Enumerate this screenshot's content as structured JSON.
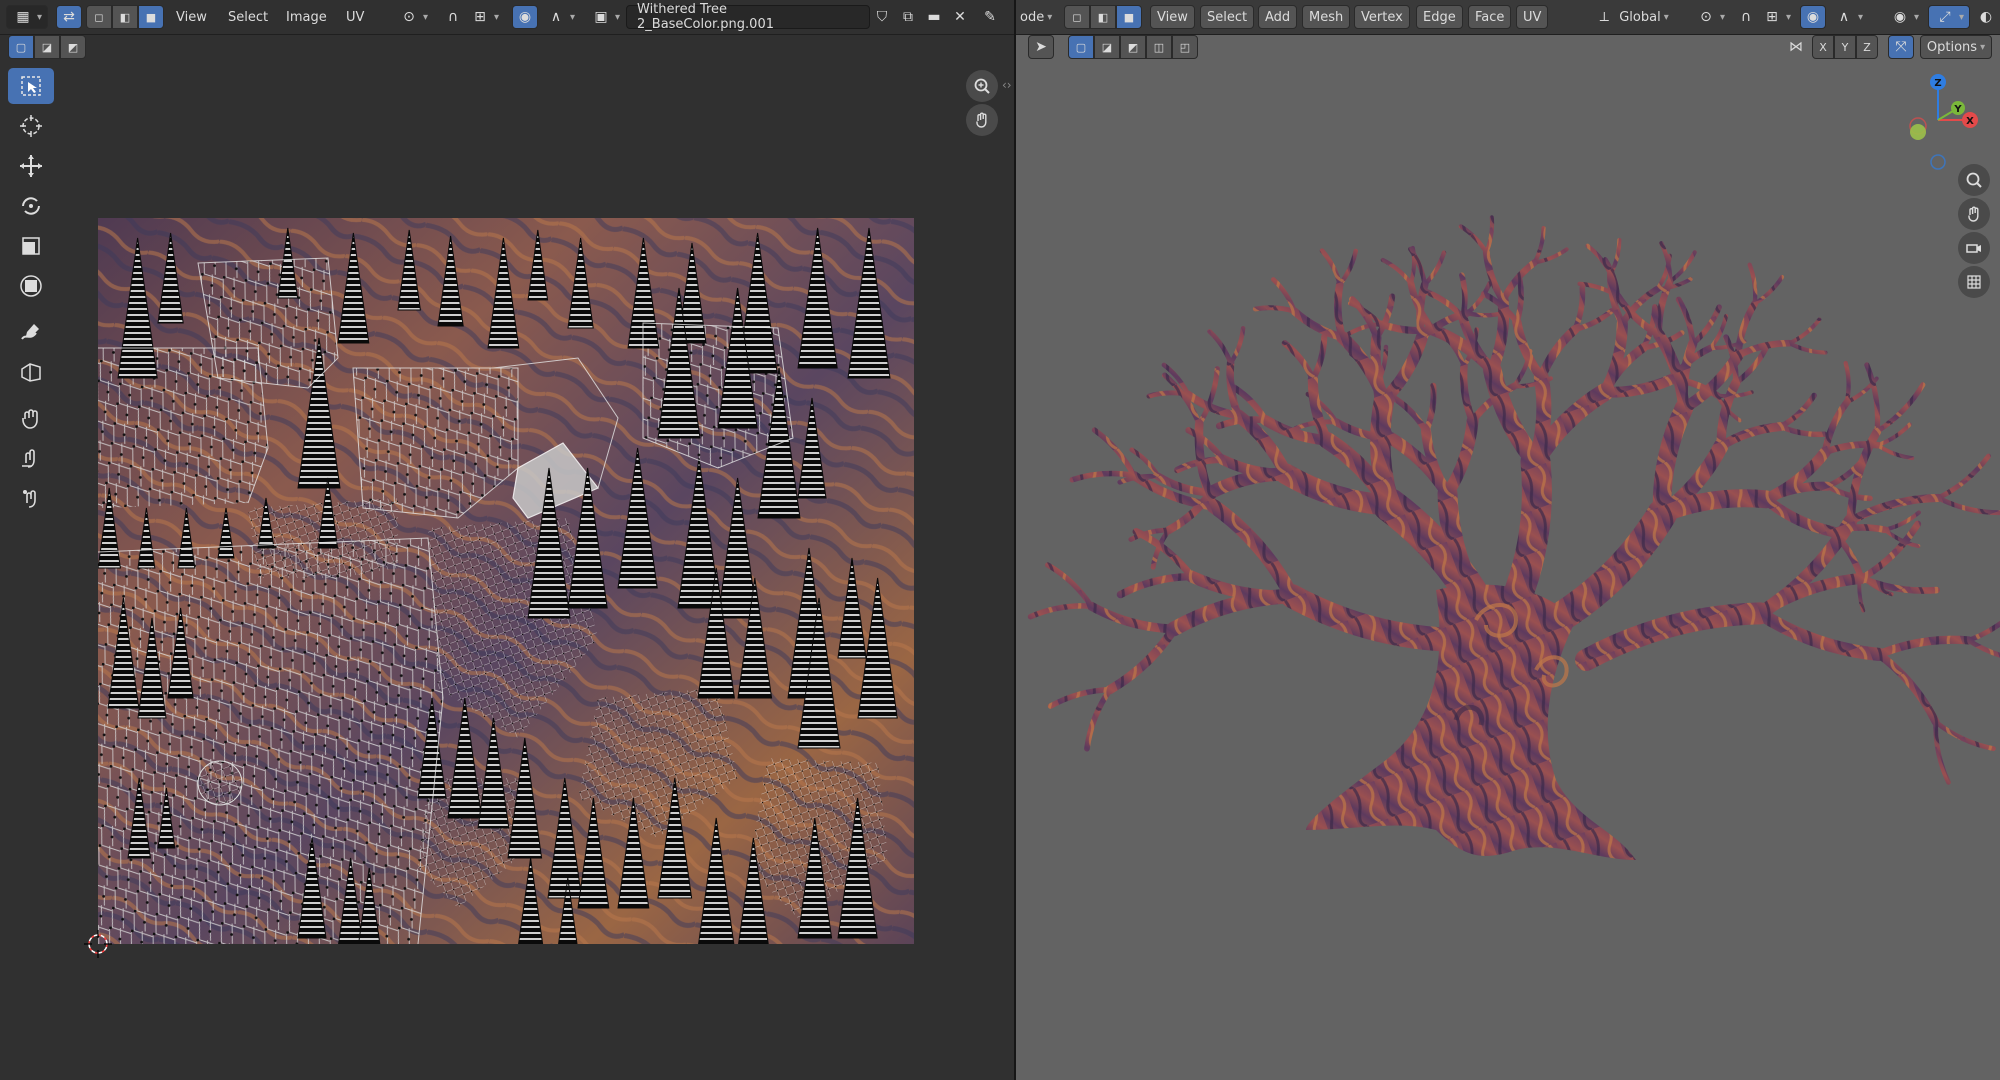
{
  "uv_editor": {
    "header": {
      "menus": [
        "View",
        "Select",
        "Image",
        "UV"
      ],
      "image_name": "Withered Tree 2_BaseColor.png.001"
    },
    "tools": [
      {
        "name": "select-box-icon",
        "active": true
      },
      {
        "name": "cursor-icon",
        "active": false
      },
      {
        "name": "move-icon",
        "active": false
      },
      {
        "name": "rotate-icon",
        "active": false
      },
      {
        "name": "scale-icon",
        "active": false
      },
      {
        "name": "transform-icon",
        "active": false
      },
      {
        "name": "annotate-icon",
        "active": false
      },
      {
        "name": "rip-icon",
        "active": false
      },
      {
        "name": "grab-icon",
        "active": false
      },
      {
        "name": "relax-icon",
        "active": false
      },
      {
        "name": "pinch-icon",
        "active": false
      }
    ],
    "nav": [
      "zoom-icon",
      "pan-icon"
    ]
  },
  "viewport": {
    "header": {
      "mode_label": "ode",
      "menus": [
        "View",
        "Select",
        "Add",
        "Mesh",
        "Vertex",
        "Edge",
        "Face",
        "UV"
      ],
      "transform_orientation": "Global",
      "axes": [
        "X",
        "Y",
        "Z"
      ],
      "options_label": "Options"
    },
    "gizmo": {
      "x": "X",
      "y": "Y",
      "z": "Z"
    },
    "nav": [
      "zoom-icon",
      "pan-icon",
      "camera-icon",
      "grid-icon"
    ]
  },
  "colors": {
    "accent": "#4772b3",
    "uv_bg": "#303030",
    "viewport_bg": "#636363",
    "bark_dark": "#4a2f4c",
    "bark_mid": "#7a4560",
    "bark_light": "#b06a48"
  }
}
